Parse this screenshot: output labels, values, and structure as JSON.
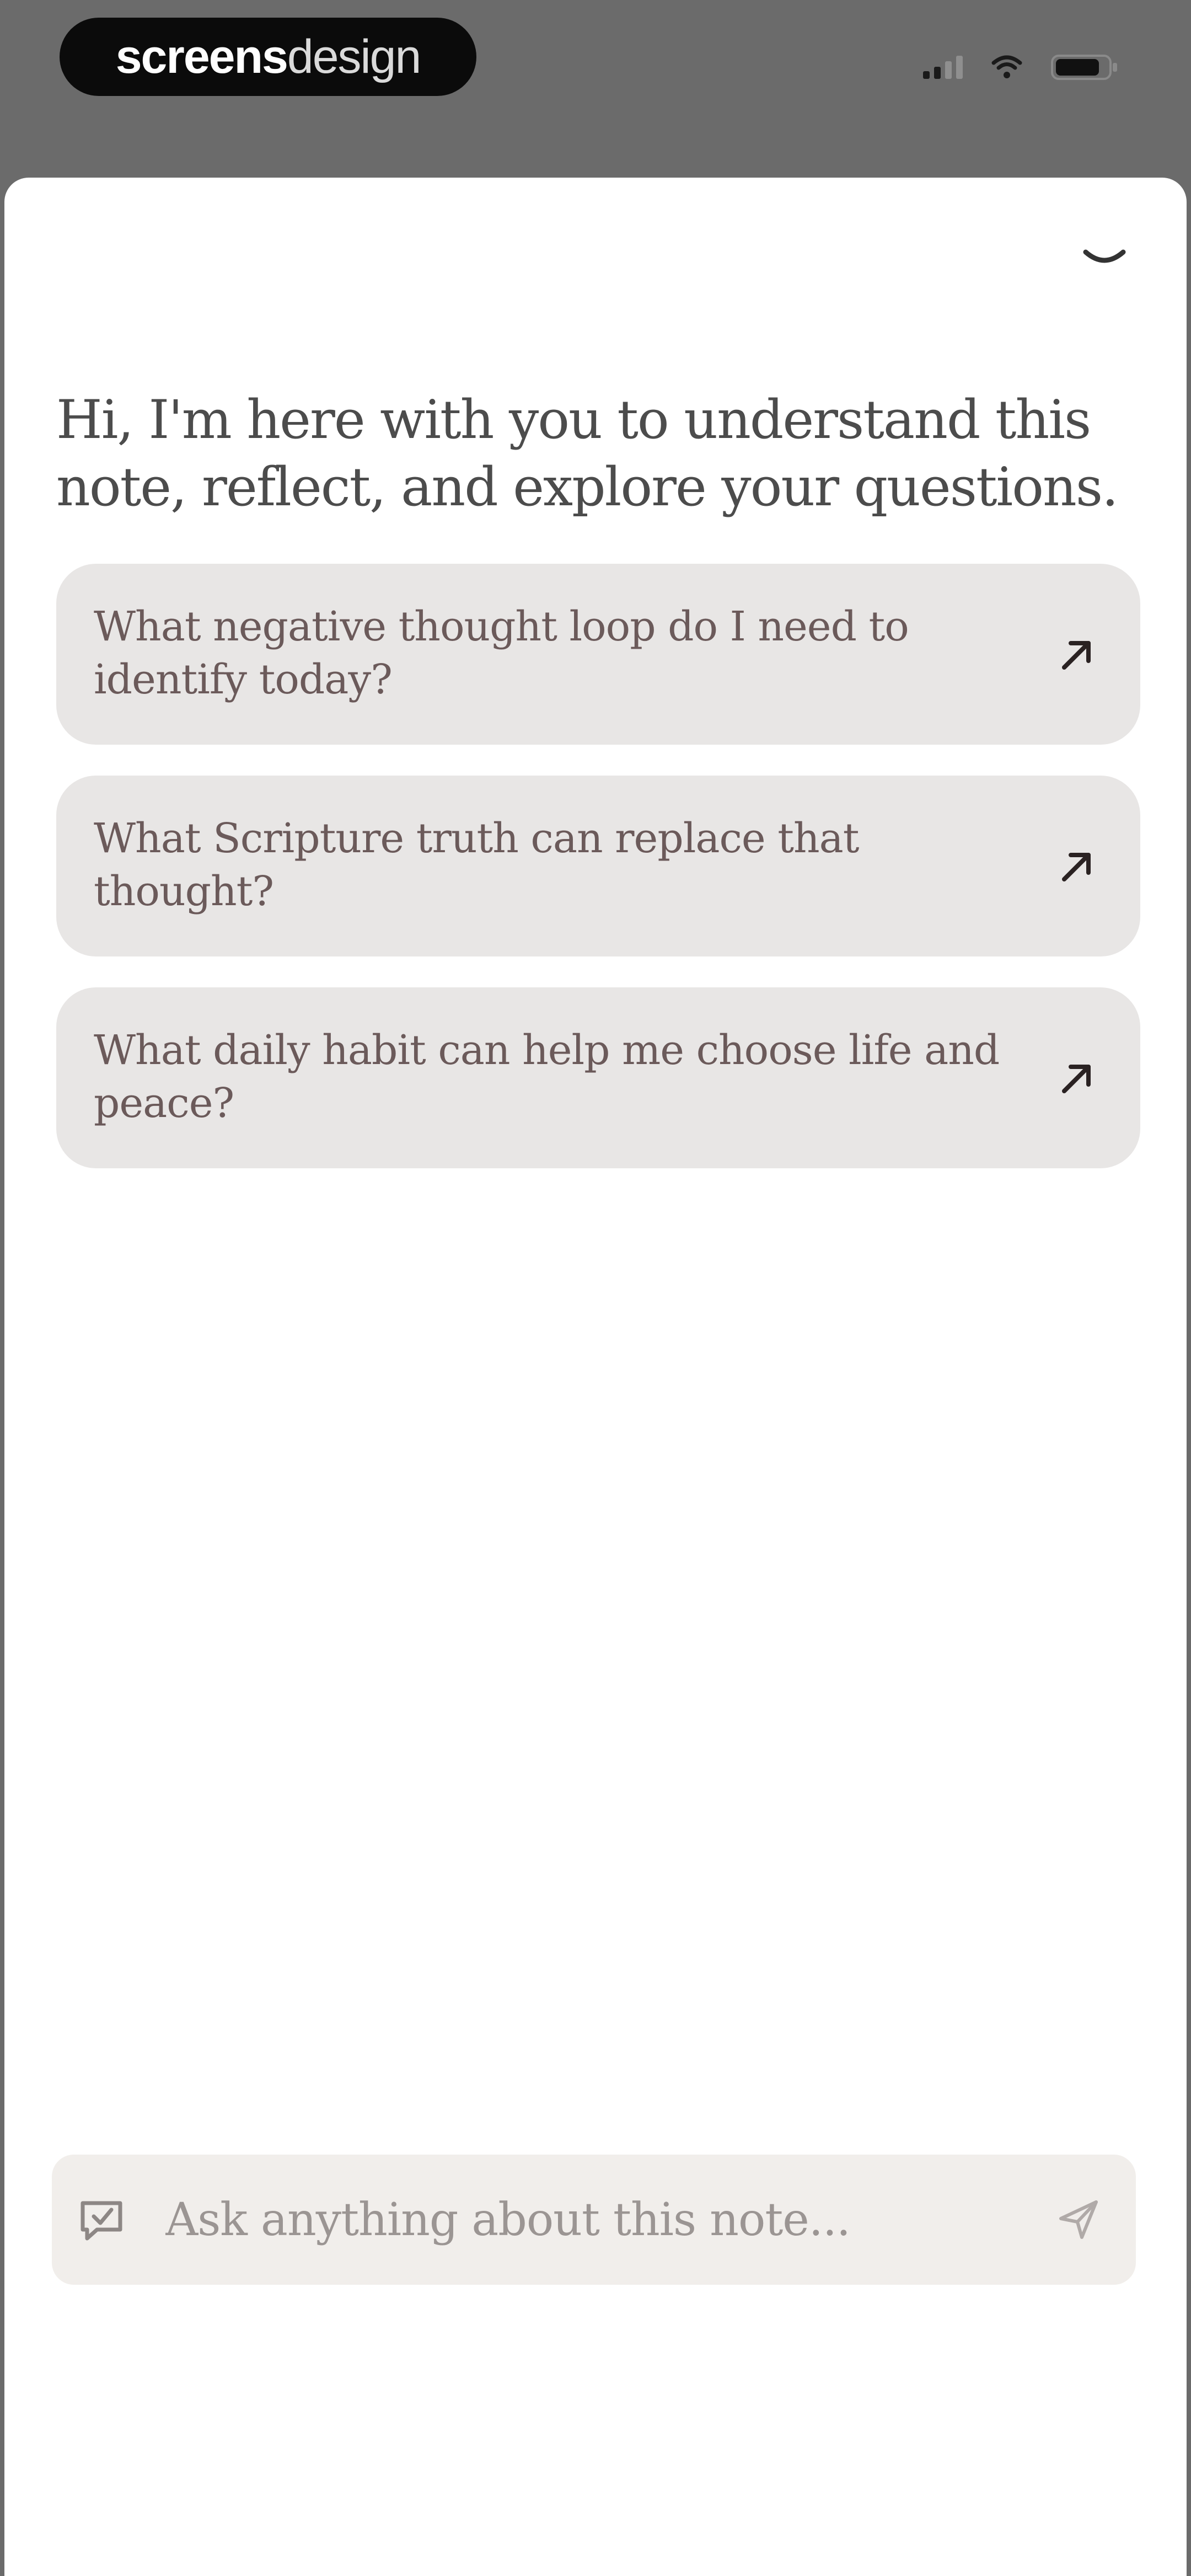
{
  "status_bar": {
    "brand_strong": "screens",
    "brand_light": "design"
  },
  "sheet": {
    "collapse_icon": "chevron-down-icon",
    "greeting": "Hi, I'm here with you to understand this note, reflect, and explore your questions.",
    "suggestions": [
      {
        "label": "What negative thought loop do I need to identify today?",
        "icon": "arrow-up-right-icon"
      },
      {
        "label": "What Scripture truth can replace that thought?",
        "icon": "arrow-up-right-icon"
      },
      {
        "label": "What daily habit can help me choose life and peace?",
        "icon": "arrow-up-right-icon"
      }
    ]
  },
  "ask_bar": {
    "placeholder": "Ask anything about this note...",
    "left_icon": "note-chat-icon",
    "send_icon": "send-icon"
  },
  "colors": {
    "status_bar_bg": "#6b6b6b",
    "sheet_bg": "#ffffff",
    "card_bg": "#e8e6e5",
    "card_text": "#6b5a5a",
    "greeting_text": "#4c4c4c",
    "input_bg": "#f1eeeb"
  }
}
